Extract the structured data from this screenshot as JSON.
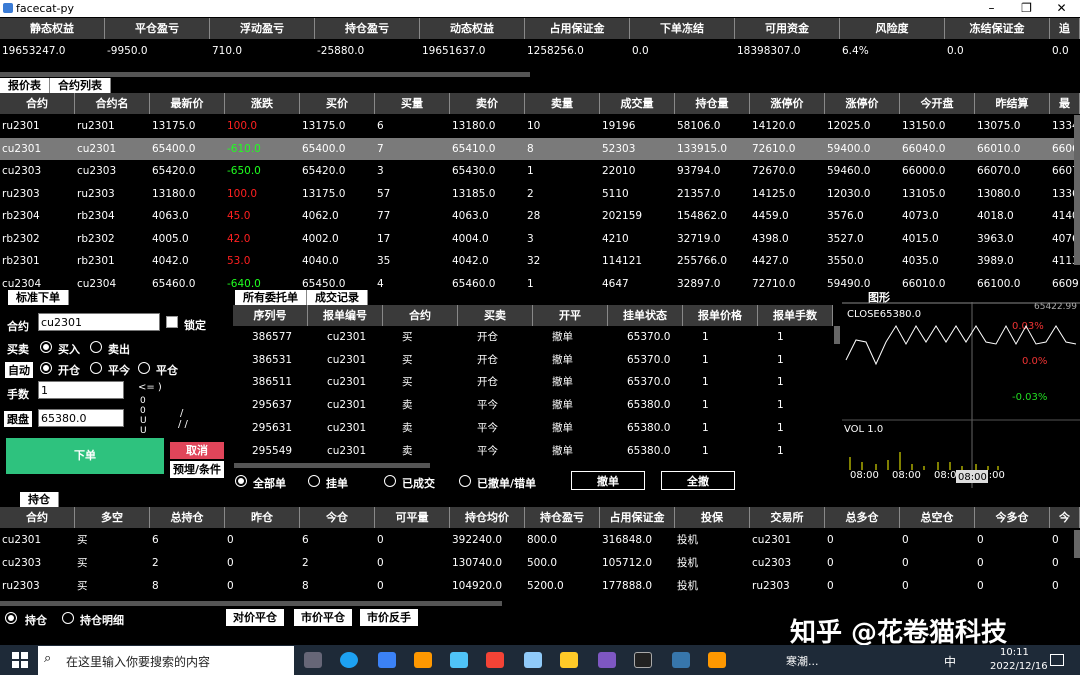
{
  "window": {
    "title": "facecat-py",
    "min": "–",
    "max": "❐",
    "close": "✕"
  },
  "account": {
    "headers": [
      "静态权益",
      "平仓盈亏",
      "浮动盈亏",
      "持仓盈亏",
      "动态权益",
      "占用保证金",
      "下单冻结",
      "可用资金",
      "风险度",
      "冻结保证金",
      "追"
    ],
    "values": [
      "19653247.0",
      "-9950.0",
      "710.0",
      "-25880.0",
      "19651637.0",
      "1258256.0",
      "0.0",
      "18398307.0",
      "6.4%",
      "0.0",
      "0.0"
    ]
  },
  "quote_tabs": [
    "报价表",
    "合约列表"
  ],
  "quote": {
    "headers": [
      "合约",
      "合约名",
      "最新价",
      "涨跌",
      "买价",
      "买量",
      "卖价",
      "卖量",
      "成交量",
      "持仓量",
      "涨停价",
      "涨停价",
      "今开盘",
      "昨结算",
      "最"
    ],
    "rows": [
      [
        "ru2301",
        "ru2301",
        "13175.0",
        "100.0",
        "13175.0",
        "6",
        "13180.0",
        "10",
        "19196",
        "58106.0",
        "14120.0",
        "12025.0",
        "13150.0",
        "13075.0",
        "1334"
      ],
      [
        "cu2301",
        "cu2301",
        "65400.0",
        "-610.0",
        "65400.0",
        "7",
        "65410.0",
        "8",
        "52303",
        "133915.0",
        "72610.0",
        "59400.0",
        "66040.0",
        "66010.0",
        "6606"
      ],
      [
        "cu2303",
        "cu2303",
        "65420.0",
        "-650.0",
        "65420.0",
        "3",
        "65430.0",
        "1",
        "22010",
        "93794.0",
        "72670.0",
        "59460.0",
        "66000.0",
        "66070.0",
        "6607"
      ],
      [
        "ru2303",
        "ru2303",
        "13180.0",
        "100.0",
        "13175.0",
        "57",
        "13185.0",
        "2",
        "5110",
        "21357.0",
        "14125.0",
        "12030.0",
        "13105.0",
        "13080.0",
        "1336"
      ],
      [
        "rb2304",
        "rb2304",
        "4063.0",
        "45.0",
        "4062.0",
        "77",
        "4063.0",
        "28",
        "202159",
        "154862.0",
        "4459.0",
        "3576.0",
        "4073.0",
        "4018.0",
        "4140"
      ],
      [
        "rb2302",
        "rb2302",
        "4005.0",
        "42.0",
        "4002.0",
        "17",
        "4004.0",
        "3",
        "4210",
        "32719.0",
        "4398.0",
        "3527.0",
        "4015.0",
        "3963.0",
        "4076"
      ],
      [
        "rb2301",
        "rb2301",
        "4042.0",
        "53.0",
        "4040.0",
        "35",
        "4042.0",
        "32",
        "114121",
        "255766.0",
        "4427.0",
        "3550.0",
        "4035.0",
        "3989.0",
        "4113."
      ],
      [
        "cu2304",
        "cu2304",
        "65460.0",
        "-640.0",
        "65450.0",
        "4",
        "65460.0",
        "1",
        "4647",
        "32897.0",
        "72710.0",
        "59490.0",
        "66010.0",
        "66100.0",
        "6609"
      ]
    ]
  },
  "order": {
    "title": "标准下单",
    "contract_label": "合约",
    "contract_value": "cu2301",
    "lock_label": "锁定",
    "direction_label": "买卖",
    "buy": "买入",
    "sell": "卖出",
    "auto_label": "自动",
    "open": "开仓",
    "close_today": "平今",
    "close": "平仓",
    "qty_label": "手数",
    "qty_value": "1",
    "price_label": "跟盘",
    "price_value": "65380.0",
    "submit": "下单",
    "cancel": "取消",
    "preset": "预埋/条件",
    "glyphs": [
      "<= )",
      "0",
      "0",
      "U",
      "U",
      "/",
      "/ /"
    ]
  },
  "orders": {
    "tabs": [
      "所有委托单",
      "成交记录"
    ],
    "headers": [
      "序列号",
      "报单编号",
      "合约",
      "买卖",
      "开平",
      "挂单状态",
      "报单价格",
      "报单手数"
    ],
    "rows": [
      [
        "386577",
        "cu2301",
        "买",
        "开仓",
        "撤单",
        "65370.0",
        "1",
        "1"
      ],
      [
        "386531",
        "cu2301",
        "买",
        "开仓",
        "撤单",
        "65370.0",
        "1",
        "1"
      ],
      [
        "386511",
        "cu2301",
        "买",
        "开仓",
        "撤单",
        "65370.0",
        "1",
        "1"
      ],
      [
        "295637",
        "cu2301",
        "卖",
        "平今",
        "撤单",
        "65380.0",
        "1",
        "1"
      ],
      [
        "295631",
        "cu2301",
        "卖",
        "平今",
        "撤单",
        "65380.0",
        "1",
        "1"
      ],
      [
        "295549",
        "cu2301",
        "卖",
        "平今",
        "撤单",
        "65380.0",
        "1",
        "1"
      ]
    ],
    "filter_all": "全部单",
    "filter_pending": "挂单",
    "filter_filled": "已成交",
    "filter_cancelled": "已撤单/错单",
    "btn_cancel": "撤单",
    "btn_cancel_all": "全撤"
  },
  "chart": {
    "tab": "图形",
    "top_label": "65422.99",
    "close_label": "CLOSE65380.0",
    "pct1": "0.03%",
    "pct2": "0.0%",
    "pct3": "-0.03%",
    "vol_label": "VOL 1.0",
    "times": [
      "08:00",
      "08:00",
      "08:00",
      "08:00"
    ],
    "cursor_time": "08:00"
  },
  "positions": {
    "tab": "持仓",
    "headers": [
      "合约",
      "多空",
      "总持仓",
      "昨仓",
      "今仓",
      "可平量",
      "持仓均价",
      "持仓盈亏",
      "占用保证金",
      "投保",
      "交易所",
      "总多仓",
      "总空仓",
      "今多仓",
      "今"
    ],
    "rows": [
      [
        "cu2301",
        "买",
        "6",
        "0",
        "6",
        "0",
        "392240.0",
        "800.0",
        "316848.0",
        "投机",
        "cu2301",
        "0",
        "0",
        "0",
        "0"
      ],
      [
        "cu2303",
        "买",
        "2",
        "0",
        "2",
        "0",
        "130740.0",
        "500.0",
        "105712.0",
        "投机",
        "cu2303",
        "0",
        "0",
        "0",
        "0"
      ],
      [
        "ru2303",
        "买",
        "8",
        "0",
        "8",
        "0",
        "104920.0",
        "5200.0",
        "177888.0",
        "投机",
        "ru2303",
        "0",
        "0",
        "0",
        "0"
      ]
    ],
    "opt_pos": "持仓",
    "opt_detail": "持仓明细",
    "btn_close": "对价平仓",
    "btn_market_close": "市价平仓",
    "btn_reverse": "市价反手"
  },
  "taskbar": {
    "search_placeholder": "在这里输入你要搜索的内容",
    "weather": "寒潮...",
    "time": "10:11",
    "date": "2022/12/16",
    "ime": "中",
    "watermark": "知乎 @花卷猫科技"
  }
}
